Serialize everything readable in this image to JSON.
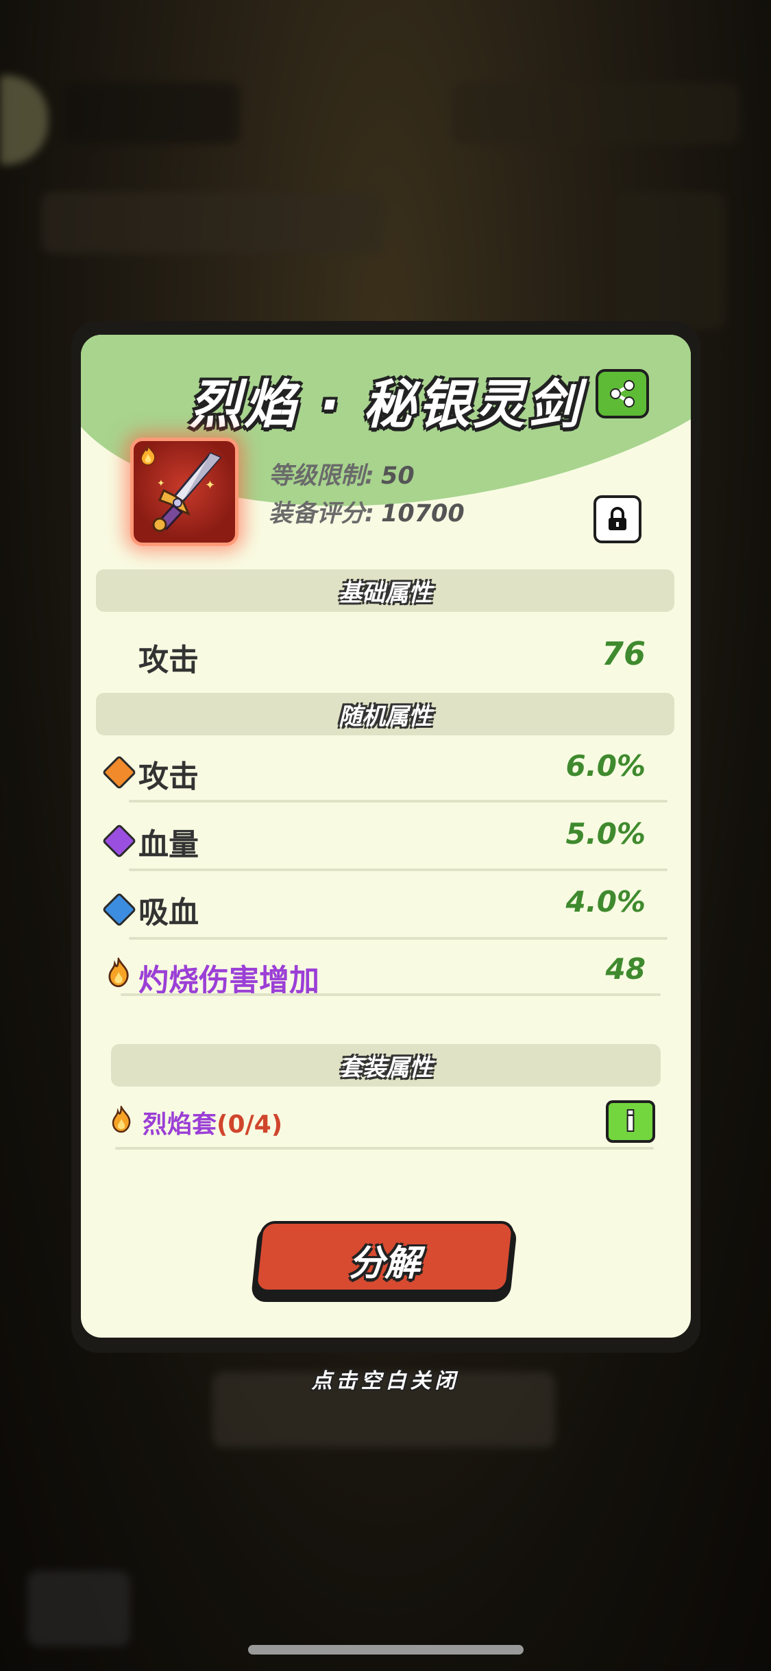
{
  "item": {
    "name": "烈焰 · 秘银灵剑",
    "level_label": "等级限制:",
    "level_value": "50",
    "score_label": "装备评分:",
    "score_value": "10700"
  },
  "sections": {
    "base": "基础属性",
    "random": "随机属性",
    "set": "套装属性"
  },
  "base_stats": [
    {
      "label": "攻击",
      "value": "76"
    }
  ],
  "random_stats": [
    {
      "label": "攻击",
      "value": "6.0%",
      "gem": "orange-gem-icon"
    },
    {
      "label": "血量",
      "value": "5.0%",
      "gem": "purple-gem-icon"
    },
    {
      "label": "吸血",
      "value": "4.0%",
      "gem": "blue-gem-icon"
    }
  ],
  "special_stat": {
    "label": "灼烧伤害增加",
    "value": "48",
    "icon": "flame-icon"
  },
  "set_bonus": {
    "name": "烈焰套",
    "progress": "(0/4)",
    "icon": "flame-icon"
  },
  "buttons": {
    "decompose": "分解",
    "info": "i"
  },
  "close_hint": "点击空白关闭",
  "colors": {
    "stat_value_green": "#3f8a2e",
    "special_purple": "#9b3fd6",
    "set_progress_red": "#d0452c",
    "decompose_red": "#d84b31",
    "info_green": "#74d63f"
  }
}
